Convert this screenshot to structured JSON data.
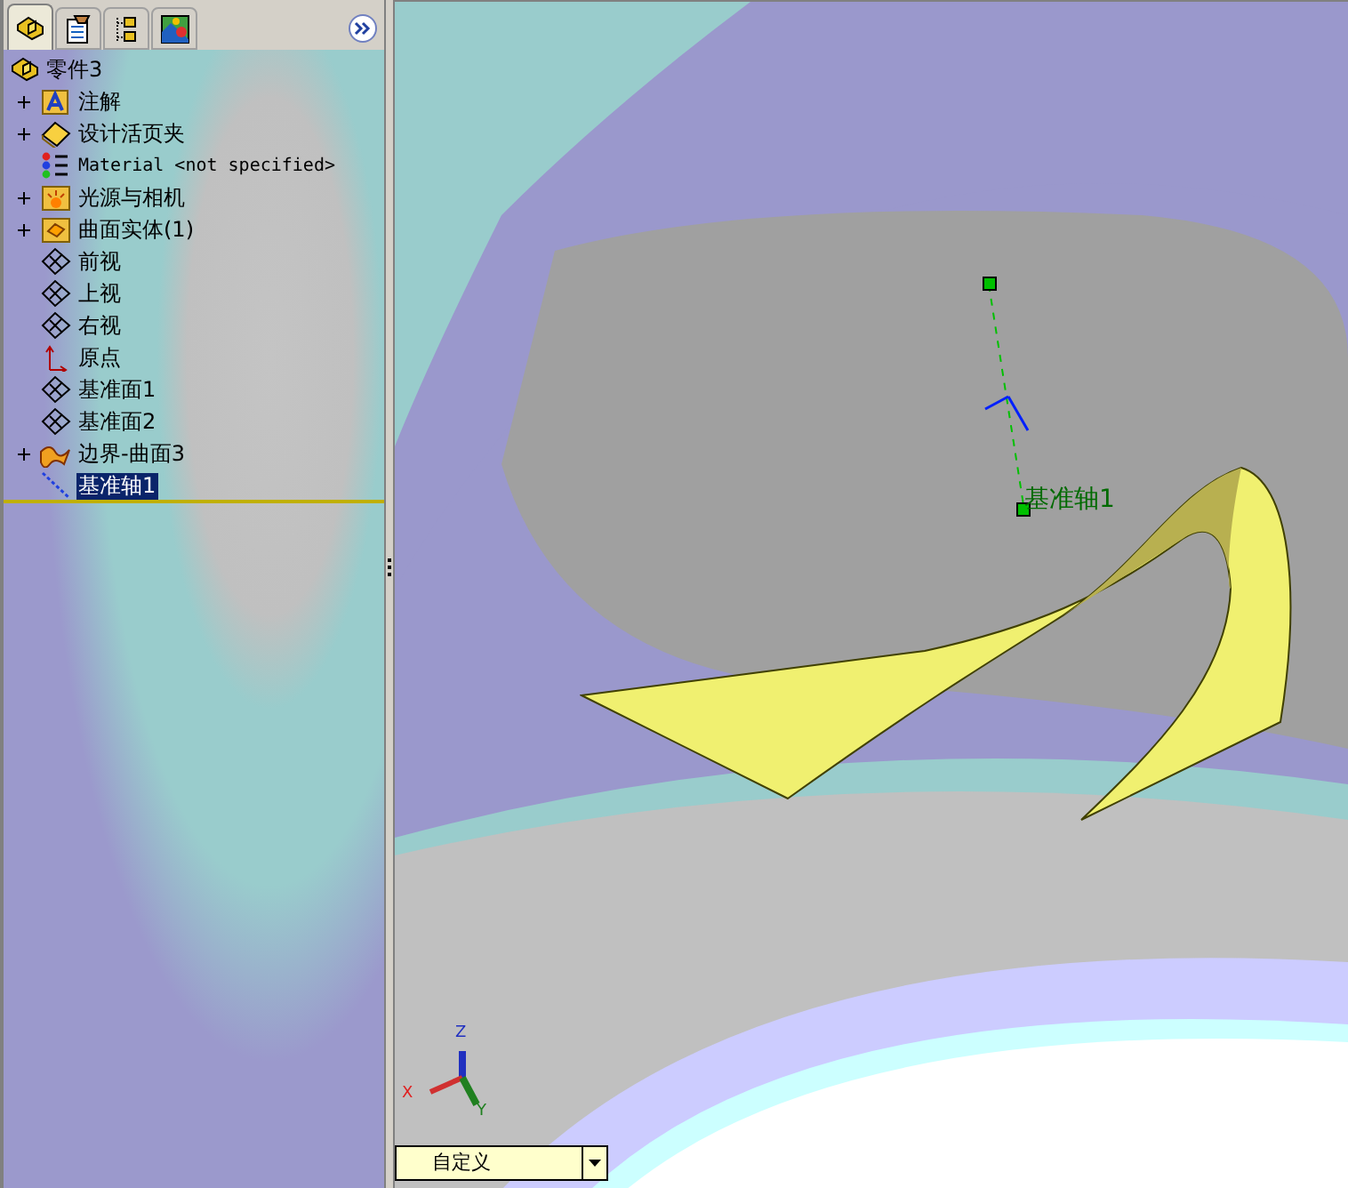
{
  "panel_tabs": [
    {
      "selected": true
    },
    {
      "selected": false
    },
    {
      "selected": false
    },
    {
      "selected": false
    }
  ],
  "tree": {
    "label": "零件3",
    "children": [
      {
        "label": "注解",
        "kind": "annotation",
        "collapsed": true,
        "selected": false
      },
      {
        "label": "设计活页夹",
        "kind": "binder",
        "collapsed": true,
        "selected": false
      },
      {
        "label": "Material <not specified>",
        "kind": "material",
        "collapsed": false,
        "selected": false
      },
      {
        "label": "光源与相机",
        "kind": "lights",
        "collapsed": true,
        "selected": false
      },
      {
        "label": "曲面实体(1)",
        "kind": "bodies",
        "collapsed": true,
        "selected": false
      },
      {
        "label": "前视",
        "kind": "plane",
        "collapsed": false,
        "selected": false
      },
      {
        "label": "上视",
        "kind": "plane",
        "collapsed": false,
        "selected": false
      },
      {
        "label": "右视",
        "kind": "plane",
        "collapsed": false,
        "selected": false
      },
      {
        "label": "原点",
        "kind": "origin",
        "collapsed": false,
        "selected": false
      },
      {
        "label": "基准面1",
        "kind": "plane",
        "collapsed": false,
        "selected": false
      },
      {
        "label": "基准面2",
        "kind": "plane",
        "collapsed": false,
        "selected": false
      },
      {
        "label": "边界-曲面3",
        "kind": "surface",
        "collapsed": true,
        "selected": false
      },
      {
        "label": "基准轴1",
        "kind": "axis",
        "collapsed": false,
        "selected": true
      }
    ]
  },
  "viewport": {
    "axis_label": "基准轴1",
    "triad": {
      "x": "X",
      "y": "Y",
      "z": "Z"
    },
    "view_dropdown": "自定义"
  }
}
